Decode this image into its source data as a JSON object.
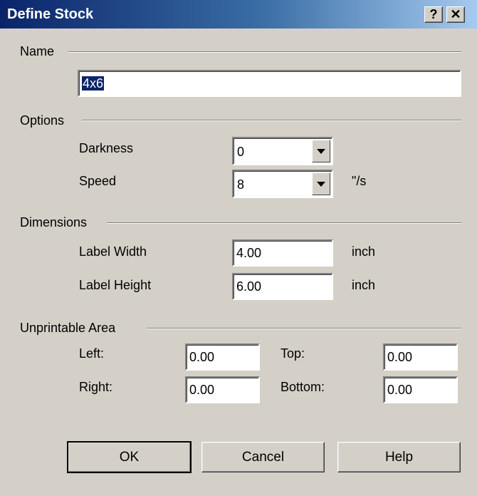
{
  "window": {
    "title": "Define Stock",
    "help_glyph": "?",
    "close_glyph": "✕"
  },
  "name_section": {
    "heading": "Name",
    "value": "4x6"
  },
  "options": {
    "heading": "Options",
    "darkness": {
      "label": "Darkness",
      "value": "0"
    },
    "speed": {
      "label": "Speed",
      "value": "8",
      "unit": "\"/s"
    }
  },
  "dimensions": {
    "heading": "Dimensions",
    "width": {
      "label": "Label Width",
      "value": "4.00",
      "unit": "inch"
    },
    "height": {
      "label": "Label Height",
      "value": "6.00",
      "unit": "inch"
    }
  },
  "unprintable": {
    "heading": "Unprintable Area",
    "left": {
      "label": "Left:",
      "value": "0.00"
    },
    "top": {
      "label": "Top:",
      "value": "0.00"
    },
    "right": {
      "label": "Right:",
      "value": "0.00"
    },
    "bottom": {
      "label": "Bottom:",
      "value": "0.00"
    }
  },
  "buttons": {
    "ok": "OK",
    "cancel": "Cancel",
    "help": "Help"
  },
  "colors": {
    "titlebar_start": "#0a246a",
    "titlebar_end": "#a6caf0",
    "face": "#d4d0c8"
  }
}
